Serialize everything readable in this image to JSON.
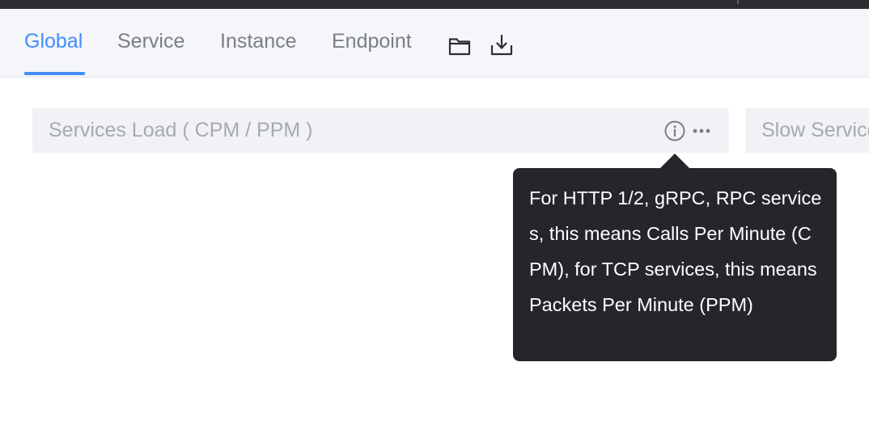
{
  "tabs": [
    {
      "label": "Global",
      "active": true
    },
    {
      "label": "Service",
      "active": false
    },
    {
      "label": "Instance",
      "active": false
    },
    {
      "label": "Endpoint",
      "active": false
    }
  ],
  "toolbar_icons": [
    "folder-icon",
    "download-icon"
  ],
  "widgets": [
    {
      "title": "Services Load ( CPM / PPM )",
      "icons": [
        "info-icon",
        "more-icon"
      ]
    },
    {
      "title": "Slow Services"
    }
  ],
  "tooltip": {
    "text": "For HTTP 1/2, gRPC, RPC services, this means Calls Per Minute (CPM), for TCP services, this means Packets Per Minute (PPM)"
  },
  "colors": {
    "accent": "#448dfe",
    "tab_inactive": "#7b7e87",
    "tab_bar_bg": "#f5f6f9",
    "widget_header_bg": "#f1f2f6",
    "widget_title": "#a7aab2",
    "tooltip_bg": "#24262b",
    "top_strip": "#2b2d33"
  }
}
